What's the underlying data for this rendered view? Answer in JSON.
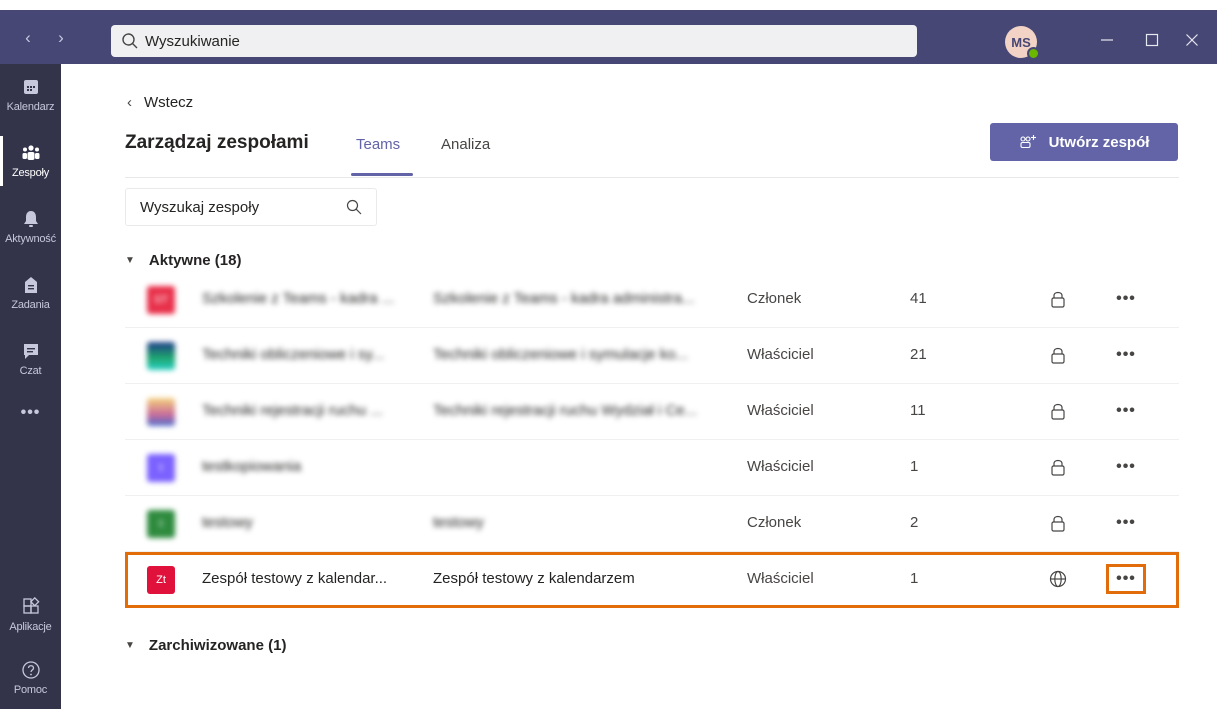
{
  "nav": {
    "back_arrow": "‹",
    "forward_arrow": "›"
  },
  "search": {
    "placeholder": "Wyszukiwanie"
  },
  "user": {
    "initials": "MS",
    "presence_color": "#6bb700"
  },
  "window": {
    "minimize": "—",
    "maximize": "☐",
    "close": "✕"
  },
  "rail": {
    "items": [
      {
        "label": "Kalendarz",
        "icon": "calendar-icon"
      },
      {
        "label": "Zespoły",
        "icon": "teams-icon",
        "active": true
      },
      {
        "label": "Aktywność",
        "icon": "bell-icon"
      },
      {
        "label": "Zadania",
        "icon": "assignments-icon"
      },
      {
        "label": "Czat",
        "icon": "chat-icon"
      },
      {
        "label": "•••",
        "icon": "more-icon"
      }
    ],
    "bottom": [
      {
        "label": "Aplikacje",
        "icon": "apps-icon"
      },
      {
        "label": "Pomoc",
        "icon": "help-icon"
      }
    ]
  },
  "header": {
    "back_label": "Wstecz",
    "title": "Zarządzaj zespołami",
    "tabs": [
      {
        "label": "Teams",
        "active": true
      },
      {
        "label": "Analiza"
      }
    ],
    "create_button": "Utwórz zespół"
  },
  "team_search": {
    "placeholder": "Wyszukaj zespoły"
  },
  "groups": {
    "active": "Aktywne (18)",
    "archived": "Zarchiwizowane (1)"
  },
  "rows": [
    {
      "avatar_text": "ST",
      "avatar_color": "#e8304a",
      "name": "Szkolenie z Teams - kadra ...",
      "desc": "Szkolenie z Teams - kadra administra...",
      "role": "Członek",
      "members": "41",
      "privacy": "private",
      "blurred": true
    },
    {
      "avatar_text": "",
      "avatar_color": "#1d3a8a",
      "name": "Techniki obliczeniowe i sy...",
      "desc": "Techniki obliczeniowe i symulacje ko...",
      "role": "Właściciel",
      "members": "21",
      "privacy": "private",
      "blurred": true
    },
    {
      "avatar_text": "",
      "avatar_color": "#f5d27a",
      "name": "Techniki rejestracji ruchu ...",
      "desc": "Techniki rejestracji ruchu Wydział i Ce...",
      "role": "Właściciel",
      "members": "11",
      "privacy": "private",
      "blurred": true
    },
    {
      "avatar_text": "t",
      "avatar_color": "#7b61ff",
      "name": "testkopiowania",
      "desc": "",
      "role": "Właściciel",
      "members": "1",
      "privacy": "private",
      "blurred": true
    },
    {
      "avatar_text": "t",
      "avatar_color": "#2e8b3e",
      "name": "testowy",
      "desc": "testowy",
      "role": "Członek",
      "members": "2",
      "privacy": "private",
      "blurred": true
    },
    {
      "avatar_text": "Zt",
      "avatar_color": "#e0123c",
      "name": "Zespół testowy z kalendar...",
      "desc": "Zespół testowy z kalendarzem",
      "role": "Właściciel",
      "members": "1",
      "privacy": "public",
      "blurred": false,
      "highlight": true
    }
  ],
  "more_label": "•••",
  "colors": {
    "brand": "#6264a7",
    "topbar": "#464775",
    "rail": "#33344a",
    "highlight": "#e36c0a"
  }
}
